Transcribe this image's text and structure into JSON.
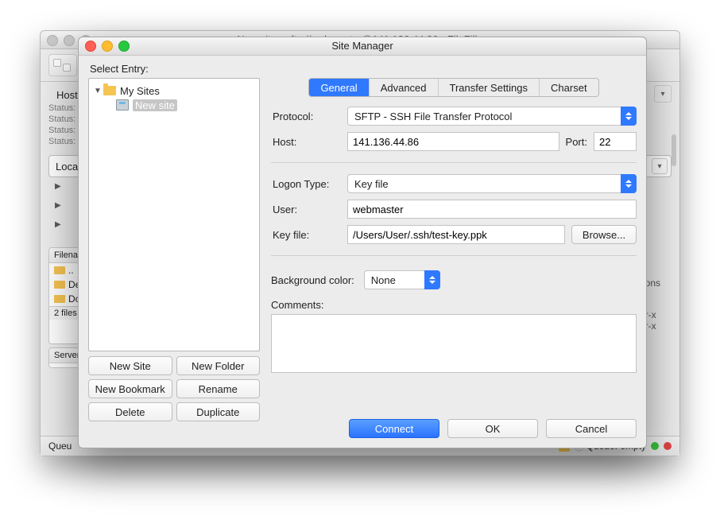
{
  "background": {
    "window_title": "New site - sftp://webmaster@141.136.44.86 - FileZilla",
    "host_label": "Host:",
    "status_lines": [
      "Status:",
      "Status:",
      "Status:",
      "Status:"
    ],
    "local_label": "Local",
    "filelist": {
      "header": "Filenam",
      "rows": [
        "..",
        "Des",
        "Doc"
      ],
      "footer": "2 files a"
    },
    "serverlist_header": "Server/",
    "permcol": {
      "header": "ons",
      "rows": [
        "r-x",
        "r-x"
      ]
    },
    "bottom": {
      "queue_label": "Queu",
      "queue_status": "Queue: empty"
    }
  },
  "dialog": {
    "title": "Site Manager",
    "select_entry_label": "Select Entry:",
    "tree": {
      "folder": "My Sites",
      "site": "New site"
    },
    "tree_buttons": [
      "New Site",
      "New Folder",
      "New Bookmark",
      "Rename",
      "Delete",
      "Duplicate"
    ],
    "tabs": [
      "General",
      "Advanced",
      "Transfer Settings",
      "Charset"
    ],
    "form": {
      "protocol_label": "Protocol:",
      "protocol_value": "SFTP - SSH File Transfer Protocol",
      "host_label": "Host:",
      "host_value": "141.136.44.86",
      "port_label": "Port:",
      "port_value": "22",
      "logon_label": "Logon Type:",
      "logon_value": "Key file",
      "user_label": "User:",
      "user_value": "webmaster",
      "keyfile_label": "Key file:",
      "keyfile_value": "/Users/User/.ssh/test-key.ppk",
      "browse_label": "Browse...",
      "bgcolor_label": "Background color:",
      "bgcolor_value": "None",
      "comments_label": "Comments:"
    },
    "footer": {
      "connect": "Connect",
      "ok": "OK",
      "cancel": "Cancel"
    }
  }
}
